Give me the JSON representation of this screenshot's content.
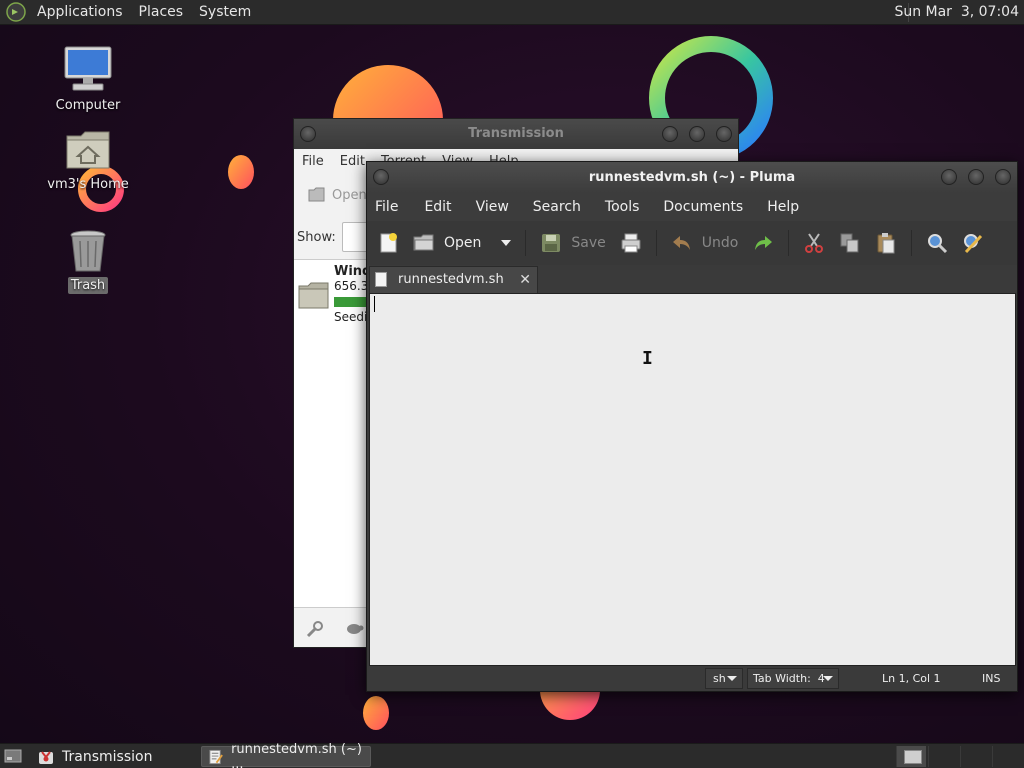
{
  "top_panel": {
    "menus": [
      "Applications",
      "Places",
      "System"
    ],
    "clock": "Sun Mar  3, 07:04"
  },
  "desktop": {
    "icons": [
      {
        "label": "Computer",
        "icon": "computer-icon"
      },
      {
        "label": "vm3's Home",
        "icon": "home-folder-icon"
      },
      {
        "label": "Trash",
        "icon": "trash-icon"
      }
    ]
  },
  "transmission": {
    "title": "Transmission",
    "menu": [
      "File",
      "Edit",
      "Torrent",
      "View",
      "Help"
    ],
    "toolbar_open": "Open",
    "show_label": "Show:",
    "torrent": {
      "name": "Wind",
      "size": "656.3",
      "status": "Seedi",
      "progress": 1.0
    }
  },
  "pluma": {
    "title": "runnestedvm.sh (~) - Pluma",
    "menu": [
      "File",
      "Edit",
      "View",
      "Search",
      "Tools",
      "Documents",
      "Help"
    ],
    "toolbar": {
      "open": "Open",
      "save": "Save",
      "undo": "Undo"
    },
    "tab": {
      "name": "runnestedvm.sh",
      "close": "✕"
    },
    "status": {
      "language": "sh",
      "tab_width": "Tab Width:  4",
      "position": "Ln 1, Col 1",
      "mode": "INS"
    }
  },
  "bottom_panel": {
    "tasks": [
      {
        "label": "Transmission",
        "icon": "transmission-icon"
      },
      {
        "label": "runnestedvm.sh (~) ...",
        "icon": "text-editor-icon"
      }
    ]
  },
  "colors": {
    "panel": "#2b2b2b",
    "window_dark": "#3a3a3a",
    "editor_bg": "#ececec",
    "progress_green": "#3a9a38"
  }
}
